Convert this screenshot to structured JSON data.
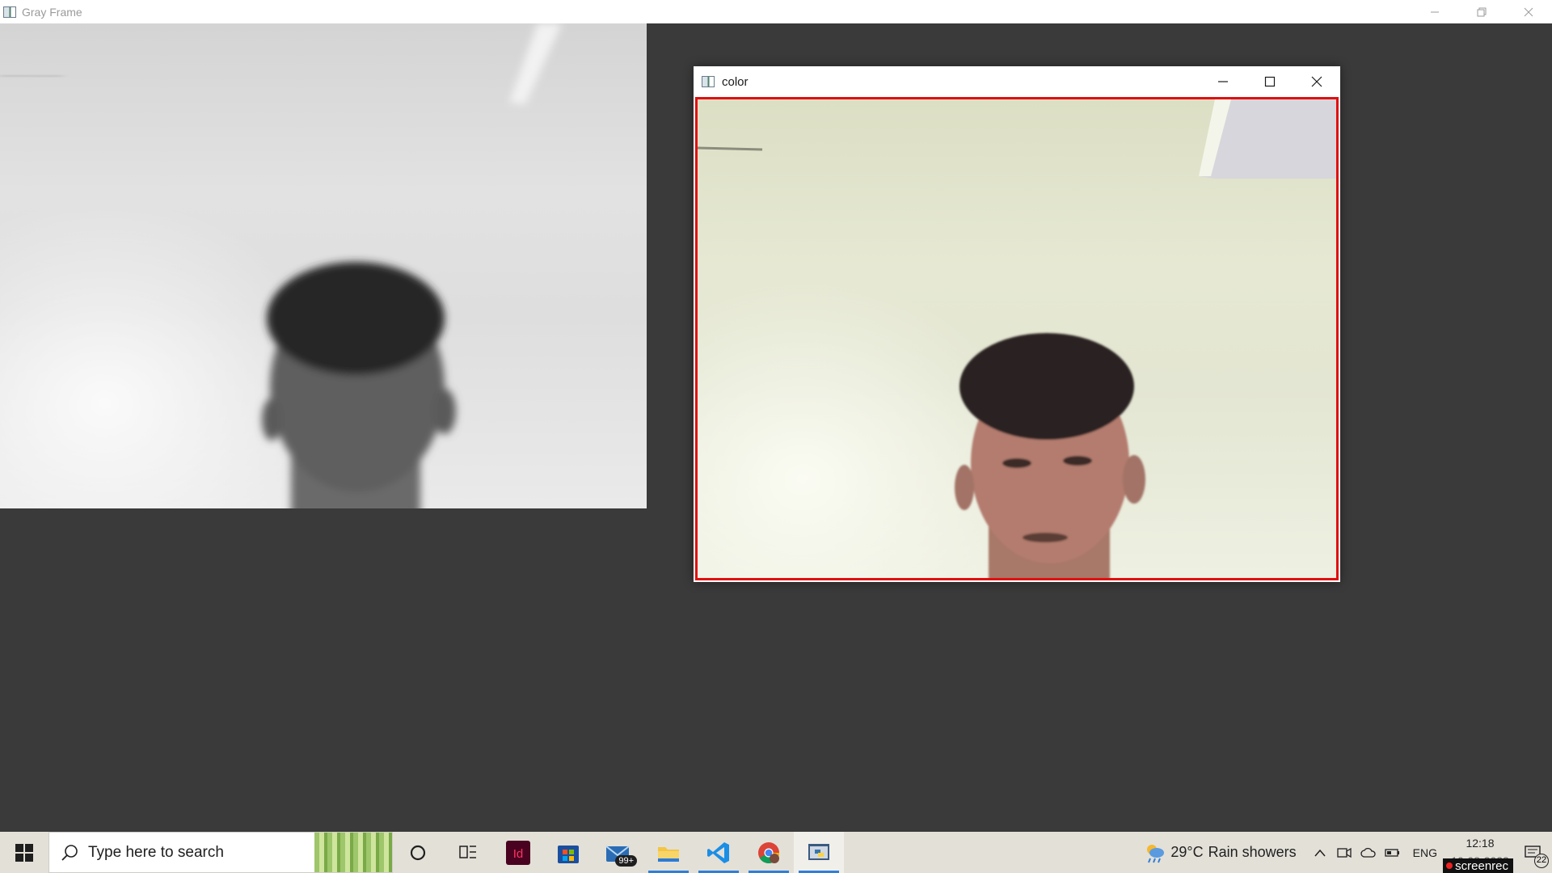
{
  "gray_window": {
    "title": "Gray Frame",
    "icon": "opencv-window-icon",
    "controls": [
      "minimize-icon",
      "restore-icon",
      "close-icon"
    ]
  },
  "color_window": {
    "title": "color",
    "icon": "opencv-window-icon",
    "controls": [
      "minimize-icon",
      "maximize-icon",
      "close-icon"
    ],
    "frame_border_color": "#e01010"
  },
  "taskbar": {
    "search_placeholder": "Type here to search",
    "apps": [
      {
        "name": "cortana-icon"
      },
      {
        "name": "task-view-icon"
      },
      {
        "name": "indesign-icon",
        "label": "Id"
      },
      {
        "name": "microsoft-store-icon"
      },
      {
        "name": "mail-icon",
        "badge": "99+"
      },
      {
        "name": "file-explorer-icon"
      },
      {
        "name": "vscode-icon"
      },
      {
        "name": "chrome-icon"
      },
      {
        "name": "python-icon"
      }
    ],
    "weather": {
      "temp": "29°C",
      "condition": "Rain showers"
    },
    "language": "ENG",
    "time": "12:18",
    "date": "10-08-2022",
    "notifications_count": "22",
    "watermark": "screenrec"
  },
  "colors": {
    "desktop_bg": "#3a3a3a",
    "taskbar_bg": "#e3e0d8",
    "accent": "#2f7fd8"
  }
}
